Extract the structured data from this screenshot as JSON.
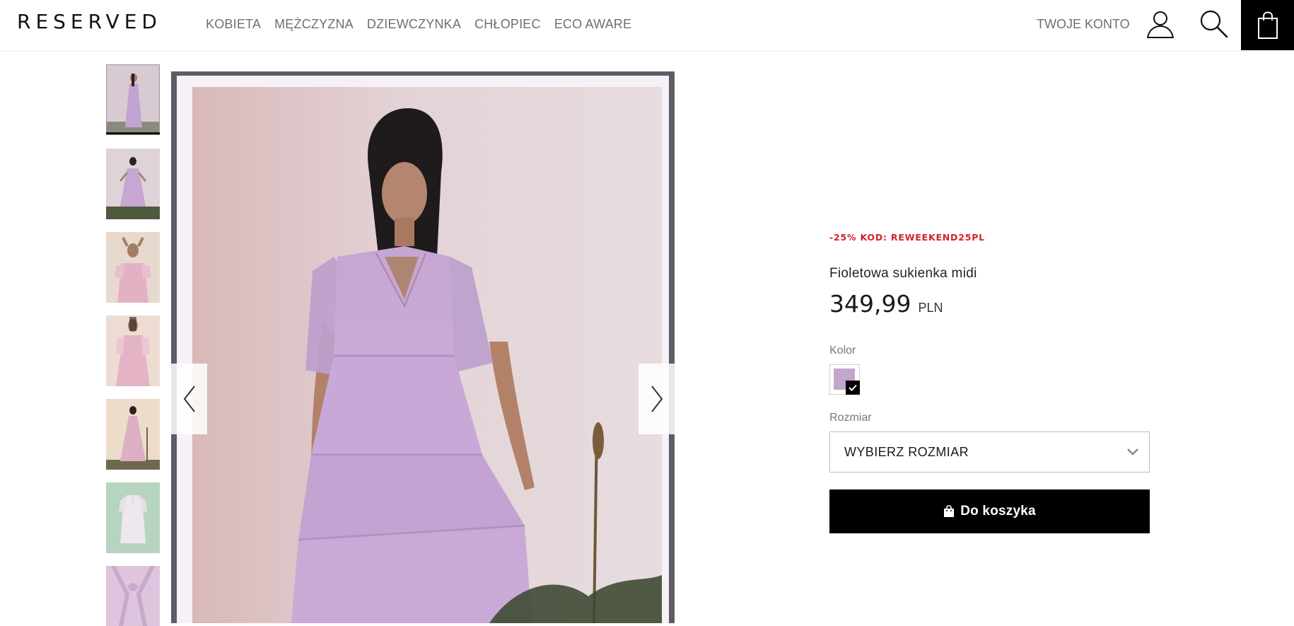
{
  "header": {
    "logo": "RESERVED",
    "nav": [
      "KOBIETA",
      "MĘŻCZYZNA",
      "DZIEWCZYNKA",
      "CHŁOPIEC",
      "ECO AWARE"
    ],
    "account_label": "TWOJE KONTO"
  },
  "product": {
    "promo": "-25% KOD: REWEEKEND25PL",
    "name": "Fioletowa sukienka midi",
    "price": "349,99",
    "currency": "PLN",
    "color_label": "Kolor",
    "size_label": "Rozmiar",
    "size_placeholder": "WYBIERZ ROZMIAR",
    "add_to_cart": "Do koszyka"
  },
  "gallery": {
    "thumbnail_count": 7,
    "active_index": 0
  },
  "colors": {
    "promo": "#d0222a",
    "swatch": "#c3a6c9",
    "dress": "#c9a9d6",
    "button": "#000000"
  }
}
